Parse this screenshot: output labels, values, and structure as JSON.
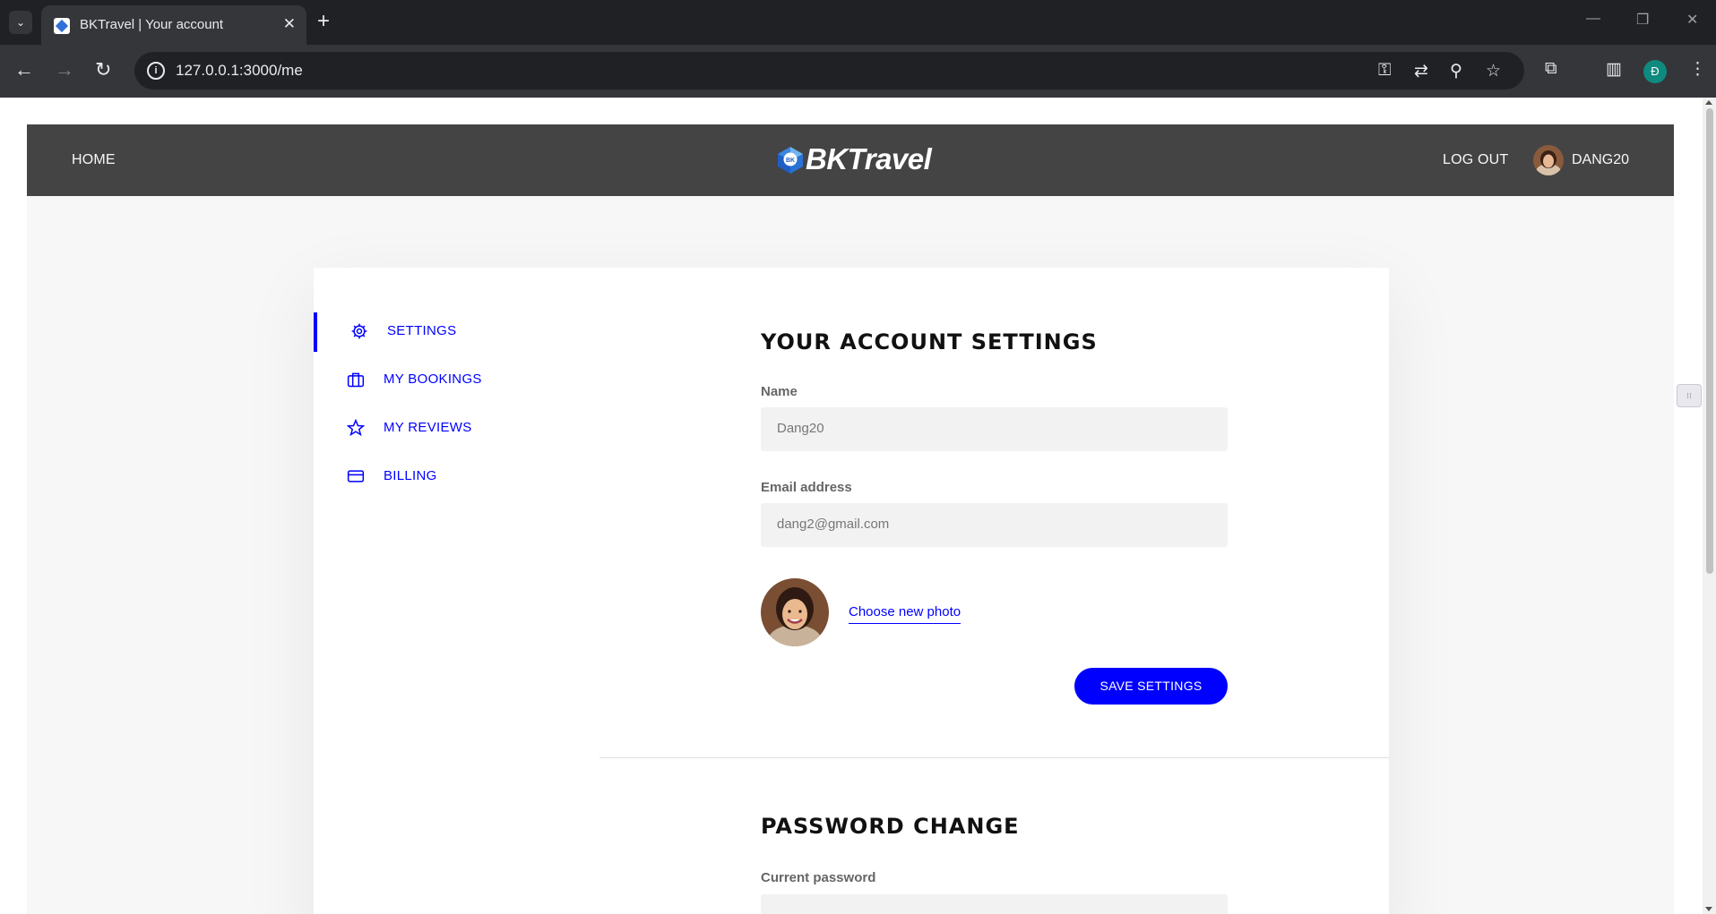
{
  "browser": {
    "tab_title": "BKTravel | Your account",
    "url": "127.0.0.1:3000/me",
    "profile_initial": "Đ"
  },
  "header": {
    "home_label": "HOME",
    "logo_text": "BKTravel",
    "logo_badge": "BK",
    "logout_label": "LOG OUT",
    "user_name": "DANG20"
  },
  "sidebar": {
    "items": [
      {
        "label": "SETTINGS",
        "icon": "gear-icon",
        "active": true
      },
      {
        "label": "MY BOOKINGS",
        "icon": "briefcase-icon",
        "active": false
      },
      {
        "label": "MY REVIEWS",
        "icon": "star-icon",
        "active": false
      },
      {
        "label": "BILLING",
        "icon": "credit-card-icon",
        "active": false
      }
    ]
  },
  "account": {
    "title": "YOUR ACCOUNT SETTINGS",
    "name_label": "Name",
    "name_value": "Dang20",
    "email_label": "Email address",
    "email_value": "dang2@gmail.com",
    "choose_photo": "Choose new photo",
    "save_label": "SAVE SETTINGS"
  },
  "password": {
    "title": "PASSWORD CHANGE",
    "current_label": "Current password"
  },
  "colors": {
    "accent": "#0000ff",
    "header_bg": "#444444",
    "page_bg": "#f7f7f7"
  }
}
